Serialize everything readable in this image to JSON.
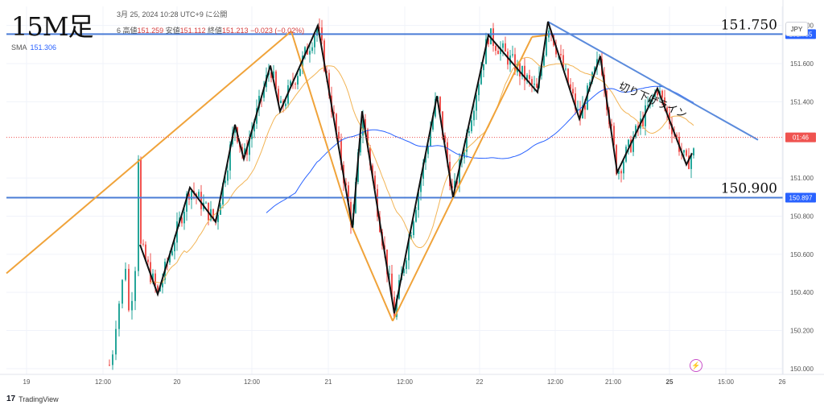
{
  "header": {
    "timeframe_label": "15M足",
    "info": "3月 25, 2024 10:28 UTC+9 に公開",
    "ohlc_prefix": "6",
    "high_label": "高値",
    "high_value": "151.259",
    "low_label": "安値",
    "low_value": "151.112",
    "close_label": "終値",
    "close_value": "151.213",
    "change": "−0.023 (−0.02%)",
    "sma_label": "SMA",
    "sma_value": "151.306",
    "currency": "JPY"
  },
  "footer": {
    "brand": "TradingView"
  },
  "colors": {
    "up": "#26a69a",
    "down": "#ef5350",
    "zigzag": "#111111",
    "orange": "#f0a33a",
    "sma_fast": "#f2b455",
    "sma_slow": "#2962ff",
    "resistance": "#4a7cd6",
    "grid": "#f0f3fa"
  },
  "chart_data": {
    "type": "candlestick",
    "y_range": [
      149.97,
      151.9
    ],
    "y_ticks": [
      "151.800",
      "151.600",
      "151.400",
      "151.000",
      "150.800",
      "150.600",
      "150.400",
      "150.200",
      "150.000"
    ],
    "x_labels": [
      "19",
      "12:00",
      "20",
      "12:00",
      "21",
      "12:00",
      "22",
      "12:00",
      "21:00",
      "25",
      "15:00",
      "26"
    ],
    "price_badges": [
      {
        "value": "151.755",
        "color": "#2962ff"
      },
      {
        "value": "01:46",
        "color": "#ef5350"
      },
      {
        "value": "150.897",
        "color": "#2962ff"
      }
    ],
    "horizontal_levels": [
      {
        "price": 151.755,
        "label": "151.750"
      },
      {
        "price": 150.897,
        "label": "150.900"
      }
    ],
    "trendline_label": "切り下げライン",
    "last_price": 151.213
  }
}
